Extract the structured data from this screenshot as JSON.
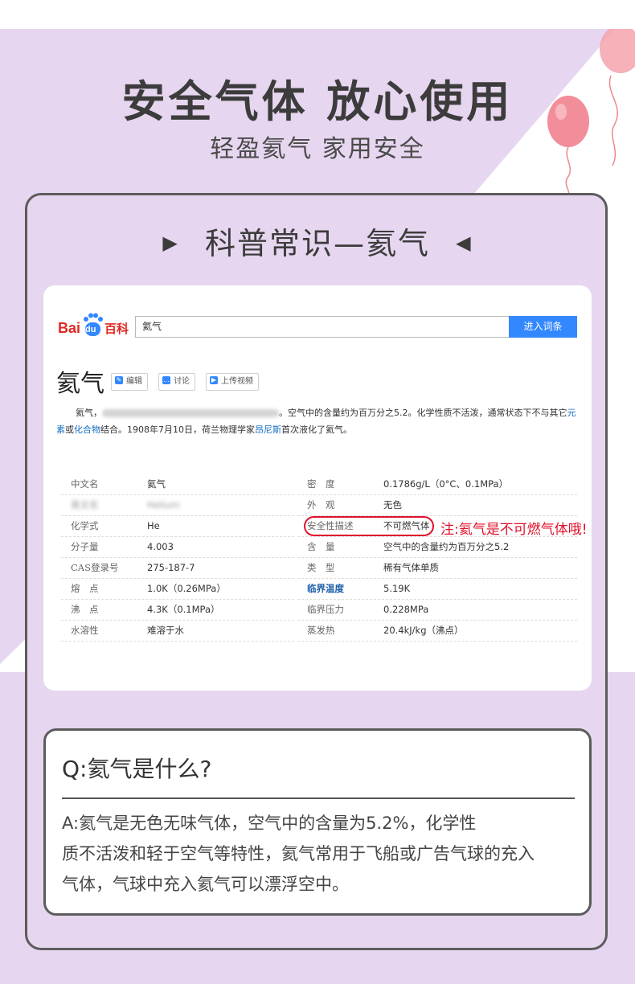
{
  "hero": {
    "title": "安全气体 放心使用",
    "subtitle": "轻盈氦气 家用安全"
  },
  "section": {
    "title": "科普常识—氦气",
    "left_marker": "▶",
    "right_marker": "◀"
  },
  "baike": {
    "logo_text_left": "Bai",
    "logo_text_du": "du",
    "logo_text_right": "百科",
    "search_value": "氦气",
    "search_button": "进入词条",
    "term": "氦气",
    "tools": [
      "编辑",
      "讨论",
      "上传视频"
    ],
    "intro": {
      "part1": "氦气，",
      "part2": "。空气中的含量约为百万分之5.2。化学性质不活泼，通常状态下不与其它",
      "link1": "元素",
      "part3": "或",
      "link2": "化合物",
      "part4": "结合。1908年7月10日，荷兰物理学家",
      "link3": "昂尼斯",
      "part5": "首次液化了氦气。"
    },
    "info_left": [
      {
        "label": "中文名",
        "value": "氦气"
      },
      {
        "label": "英文名",
        "value": "Helium"
      },
      {
        "label": "化学式",
        "value": "He"
      },
      {
        "label": "分子量",
        "value": "4.003"
      },
      {
        "label": "CAS登录号",
        "value": "275-187-7"
      },
      {
        "label": "熔　点",
        "value": "1.0K（0.26MPa）"
      },
      {
        "label": "沸　点",
        "value": "4.3K（0.1MPa）"
      },
      {
        "label": "水溶性",
        "value": "难溶于水"
      }
    ],
    "info_right": [
      {
        "label": "密　度",
        "value": "0.1786g/L（0°C、0.1MPa）"
      },
      {
        "label": "外　观",
        "value": "无色"
      },
      {
        "label": "安全性描述",
        "value": "不可燃气体"
      },
      {
        "label": "含　量",
        "value": "空气中的含量约为百万分之5.2"
      },
      {
        "label": "类　型",
        "value": "稀有气体单质"
      },
      {
        "label": "临界温度",
        "value": "5.19K"
      },
      {
        "label": "临界压力",
        "value": "0.228MPa"
      },
      {
        "label": "蒸发热",
        "value": "20.4kJ/kg（沸点）"
      }
    ],
    "note": "注:氦气是不可燃气体哦!"
  },
  "qa": {
    "question": "Q:氦气是什么?",
    "answer_line1": "A:氦气是无色无味气体，空气中的含量为5.2%，化学性",
    "answer_line2": "质不活泼和轻于空气等特性，氦气常用于飞船或广告气球的充入",
    "answer_line3": "气体，气球中充入氦气可以漂浮空中。"
  },
  "colors": {
    "background_purple": "#e6d6ef",
    "accent_red": "#e0112b",
    "baidu_blue": "#3388ff",
    "baidu_red": "#de2a23",
    "balloon_pink": "#f28e9a"
  },
  "icons": [
    "balloon-icon",
    "pencil-icon",
    "chat-icon",
    "play-icon"
  ]
}
